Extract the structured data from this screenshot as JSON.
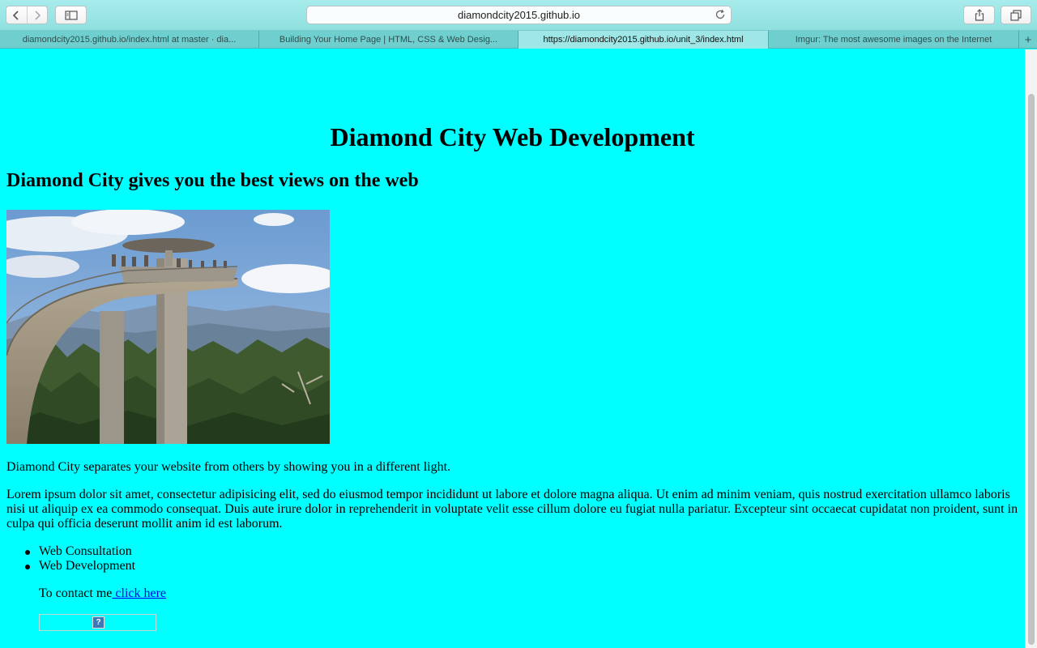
{
  "browser": {
    "address": "diamondcity2015.github.io",
    "tabs": [
      {
        "label": "diamondcity2015.github.io/index.html at master · dia...",
        "active": false
      },
      {
        "label": "Building Your Home Page | HTML, CSS & Web Desig...",
        "active": false
      },
      {
        "label": "https://diamondcity2015.github.io/unit_3/index.html",
        "active": true
      },
      {
        "label": "Imgur: The most awesome images on the Internet",
        "active": false
      }
    ],
    "new_tab_symbol": "+"
  },
  "page": {
    "background_color": "#00ffff",
    "heading": "Diamond City Web Development",
    "subheading": "Diamond City gives you the best views on the web",
    "intro": "Diamond City separates your website from others by showing you in a different light.",
    "lorem": "Lorem ipsum dolor sit amet, consectetur adipisicing elit, sed do eiusmod tempor incididunt ut labore et dolore magna aliqua. Ut enim ad minim veniam, quis nostrud exercitation ullamco laboris nisi ut aliquip ex ea commodo consequat. Duis aute irure dolor in reprehenderit in voluptate velit esse cillum dolore eu fugiat nulla pariatur. Excepteur sint occaecat cupidatat non proident, sunt in culpa qui officia deserunt mollit anim id est laborum.",
    "services": [
      "Web Consultation",
      "Web Development"
    ],
    "contact_prefix": "To contact me",
    "contact_link": " click here",
    "broken_image_glyph": "?"
  },
  "icons": {
    "back": "chevron-left-icon",
    "forward": "chevron-right-icon",
    "sidebar": "sidebar-icon",
    "reload": "reload-icon",
    "share": "share-icon",
    "tabs": "tabs-overview-icon"
  }
}
